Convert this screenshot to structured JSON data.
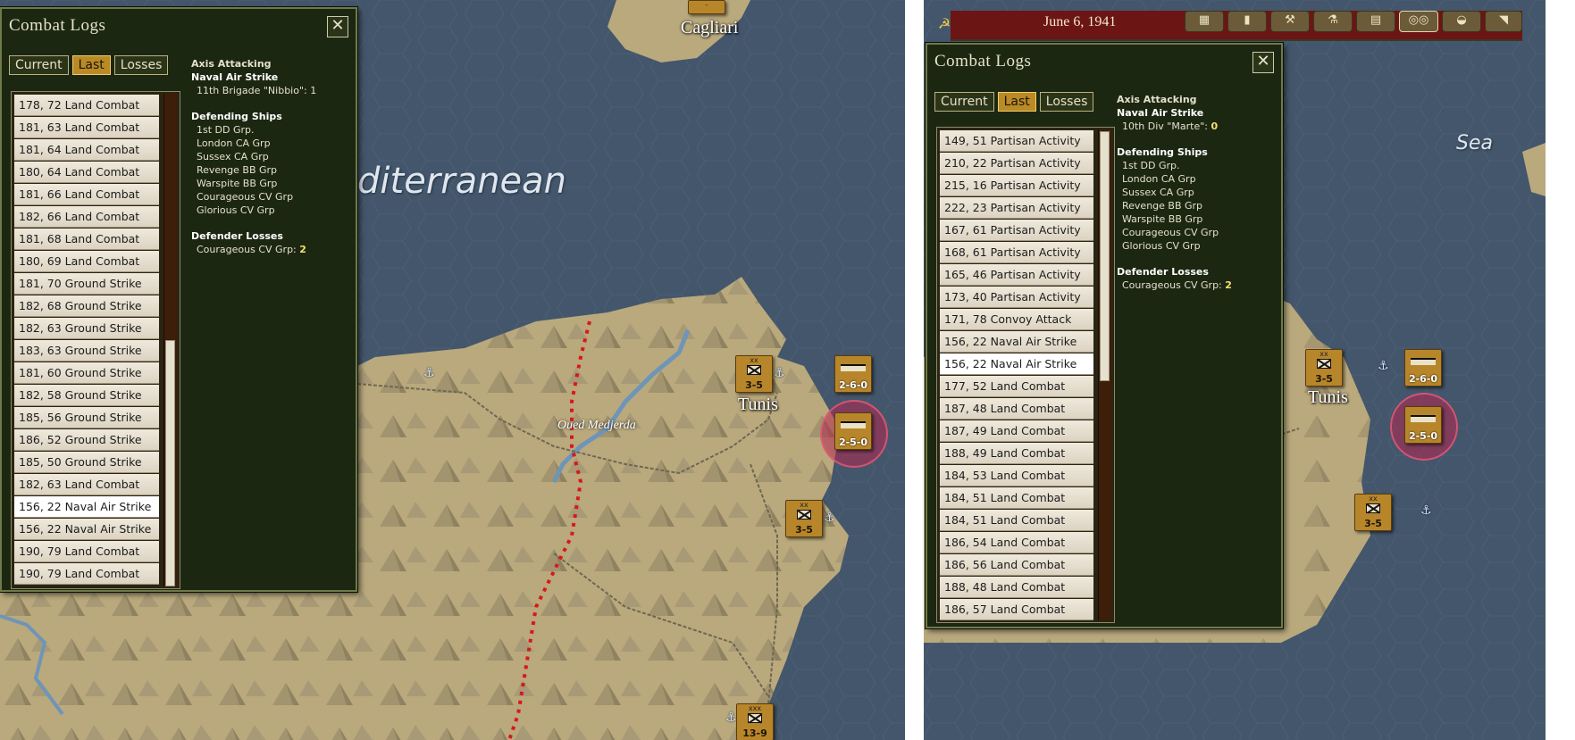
{
  "left_map": {
    "labels": {
      "city_top": "Cagliari",
      "sea": "diterranean",
      "river": "Oued Medjerda",
      "city": "Tunis"
    },
    "units": [
      {
        "size": "xx",
        "value": "3-5",
        "icon": "infantry-icon"
      },
      {
        "size": "",
        "value": "2-6-0",
        "icon": "naval-air-icon"
      },
      {
        "size": "",
        "value": "2-5-0",
        "icon": "naval-air-icon"
      },
      {
        "size": "xx",
        "value": "3-5",
        "icon": "infantry-icon"
      },
      {
        "size": "xxx",
        "value": "13-9",
        "icon": "infantry-icon"
      }
    ],
    "top_counter": "-"
  },
  "left_panel": {
    "title": "Combat Logs",
    "close": "✕",
    "tabs": {
      "current": "Current",
      "last": "Last",
      "losses": "Losses"
    },
    "items": [
      "178, 72 Land Combat",
      "181, 63 Land Combat",
      "181, 64 Land Combat",
      "180, 64 Land Combat",
      "181, 66 Land Combat",
      "182, 66 Land Combat",
      "181, 68 Land Combat",
      "180, 69 Land Combat",
      "181, 70 Ground Strike",
      "182, 68 Ground Strike",
      "182, 63 Ground Strike",
      "183, 63 Ground Strike",
      "181, 60 Ground Strike",
      "182, 58 Ground Strike",
      "185, 56 Ground Strike",
      "186, 52 Ground Strike",
      "185, 50 Ground Strike",
      "182, 63 Land Combat",
      "156, 22 Naval Air Strike",
      "156, 22 Naval Air Strike",
      "190, 79 Land Combat",
      "190, 79 Land Combat"
    ],
    "selected_index": 18,
    "detail": {
      "attacking": "Axis Attacking",
      "type": "Naval Air Strike",
      "attacker_label": "11th Brigade \"Nibbio\": ",
      "attacker_value": "1",
      "defending_title": "Defending Ships",
      "ships": [
        "1st DD Grp.",
        "London CA Grp",
        "Sussex CA Grp",
        "Revenge BB Grp",
        "Warspite BB Grp",
        "Courageous CV Grp",
        "Glorious CV Grp"
      ],
      "losses_title": "Defender Losses",
      "loss_label": "Courageous CV Grp: ",
      "loss_value": "2"
    }
  },
  "right_map": {
    "date": "June 6, 1941",
    "labels": {
      "city": "Tunis",
      "sea": "Sea"
    },
    "units": [
      {
        "size": "xx",
        "value": "3-5",
        "icon": "infantry-icon"
      },
      {
        "size": "",
        "value": "2-6-0",
        "icon": "naval-air-icon"
      },
      {
        "size": "",
        "value": "2-5-0",
        "icon": "naval-air-icon"
      },
      {
        "size": "xx",
        "value": "3-5",
        "icon": "infantry-icon"
      }
    ],
    "toolbar_icons": [
      "grid-icon",
      "briefcase-icon",
      "production-icon",
      "research-icon",
      "report-icon",
      "binoculars-icon",
      "hat-icon"
    ]
  },
  "right_panel": {
    "title": "Combat Logs",
    "close": "✕",
    "tabs": {
      "current": "Current",
      "last": "Last",
      "losses": "Losses"
    },
    "items": [
      "149, 51 Partisan Activity",
      "210, 22 Partisan Activity",
      "215, 16 Partisan Activity",
      "222, 23 Partisan Activity",
      "167, 61 Partisan Activity",
      "168, 61 Partisan Activity",
      "165, 46 Partisan Activity",
      "173, 40 Partisan Activity",
      "171, 78 Convoy Attack",
      "156, 22 Naval Air Strike",
      "156, 22 Naval Air Strike",
      "177, 52 Land Combat",
      "187, 48 Land Combat",
      "187, 49 Land Combat",
      "188, 49 Land Combat",
      "184, 53 Land Combat",
      "184, 51 Land Combat",
      "184, 51 Land Combat",
      "186, 54 Land Combat",
      "186, 56 Land Combat",
      "188, 48 Land Combat",
      "186, 57 Land Combat"
    ],
    "selected_index": 10,
    "detail": {
      "attacking": "Axis Attacking",
      "type": "Naval Air Strike",
      "attacker_label": "10th Div \"Marte\": ",
      "attacker_value": "0",
      "defending_title": "Defending Ships",
      "ships": [
        "1st DD Grp.",
        "London CA Grp",
        "Sussex CA Grp",
        "Revenge BB Grp",
        "Warspite BB Grp",
        "Courageous CV Grp",
        "Glorious CV Grp"
      ],
      "losses_title": "Defender Losses",
      "loss_label": "Courageous CV Grp: ",
      "loss_value": "2"
    }
  },
  "colors": {
    "sea": "#43566b",
    "land": "#b9a97d",
    "panel": "#1c2712",
    "tab_active": "#b98a26",
    "highlight": "#ffffff",
    "soviet_red": "#6c1515"
  }
}
